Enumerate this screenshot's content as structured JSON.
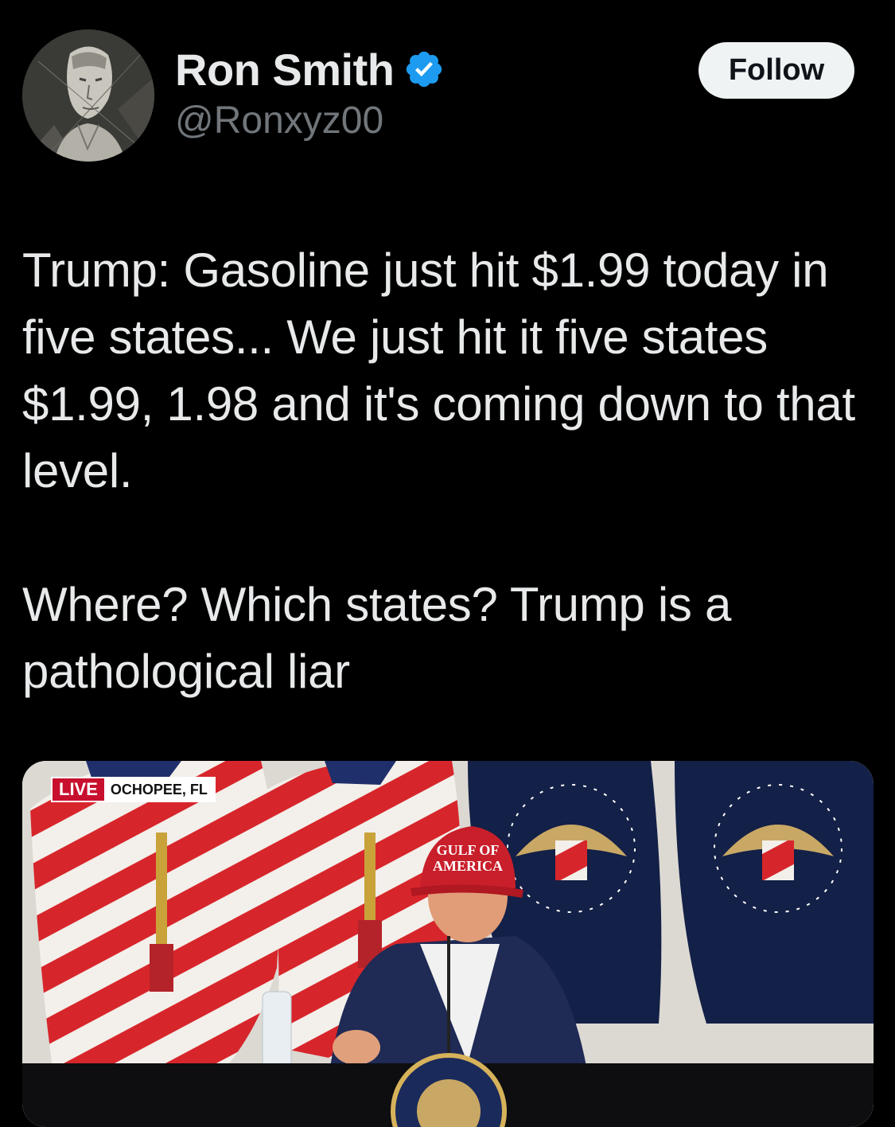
{
  "author": {
    "display_name": "Ron Smith",
    "handle": "@Ronxyz00",
    "verified": true,
    "verified_color": "#1d9bf0",
    "avatar_icon": "avatar-image"
  },
  "actions": {
    "follow_label": "Follow"
  },
  "tweet": {
    "paragraphs": [
      "Trump: Gasoline just hit $1.99 today in five states... We just hit it five states $1.99, 1.98 and it's coming down to that level.",
      "Where? Which states? Trump is a pathological liar"
    ]
  },
  "media": {
    "live_label": "LIVE",
    "location": "OCHOPEE, FL",
    "cap_text_line1": "GULF OF",
    "cap_text_line2": "AMERICA"
  },
  "colors": {
    "background": "#000000",
    "text_primary": "#e7e9ea",
    "text_secondary": "#71767b",
    "follow_bg": "#eff3f4",
    "live_red": "#c8102e"
  }
}
